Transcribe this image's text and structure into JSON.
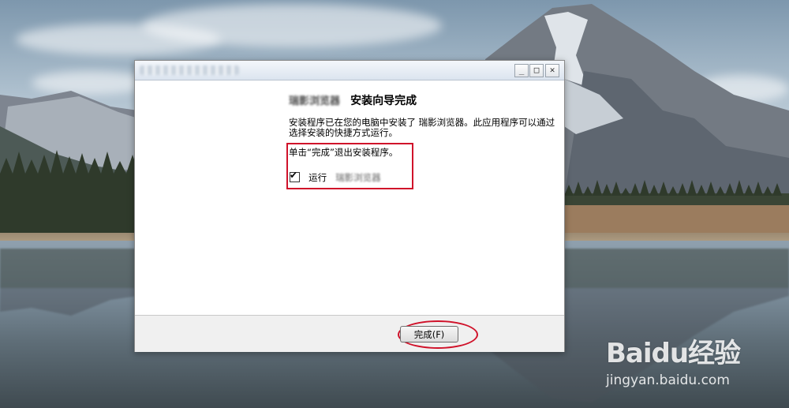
{
  "window": {
    "title": "",
    "controls": {
      "minimize": "_",
      "maximize": "□",
      "close": "✕"
    }
  },
  "content": {
    "app_name": "瑞影浏览器",
    "heading": "安装向导完成",
    "description": "安装程序已在您的电脑中安装了 瑞影浏览器。此应用程序可以通过选择安装的快捷方式运行。",
    "exit_instruction": "单击“完成”退出安装程序。",
    "run_checkbox": {
      "checked": true,
      "label": "运行",
      "app_name": "瑞影浏览器"
    }
  },
  "footer": {
    "finish_label": "完成(F)"
  },
  "annotations": {
    "highlight_color": "#d0122a"
  },
  "watermark": {
    "text": "Baidu经验",
    "url": "jingyan.baidu.com"
  }
}
